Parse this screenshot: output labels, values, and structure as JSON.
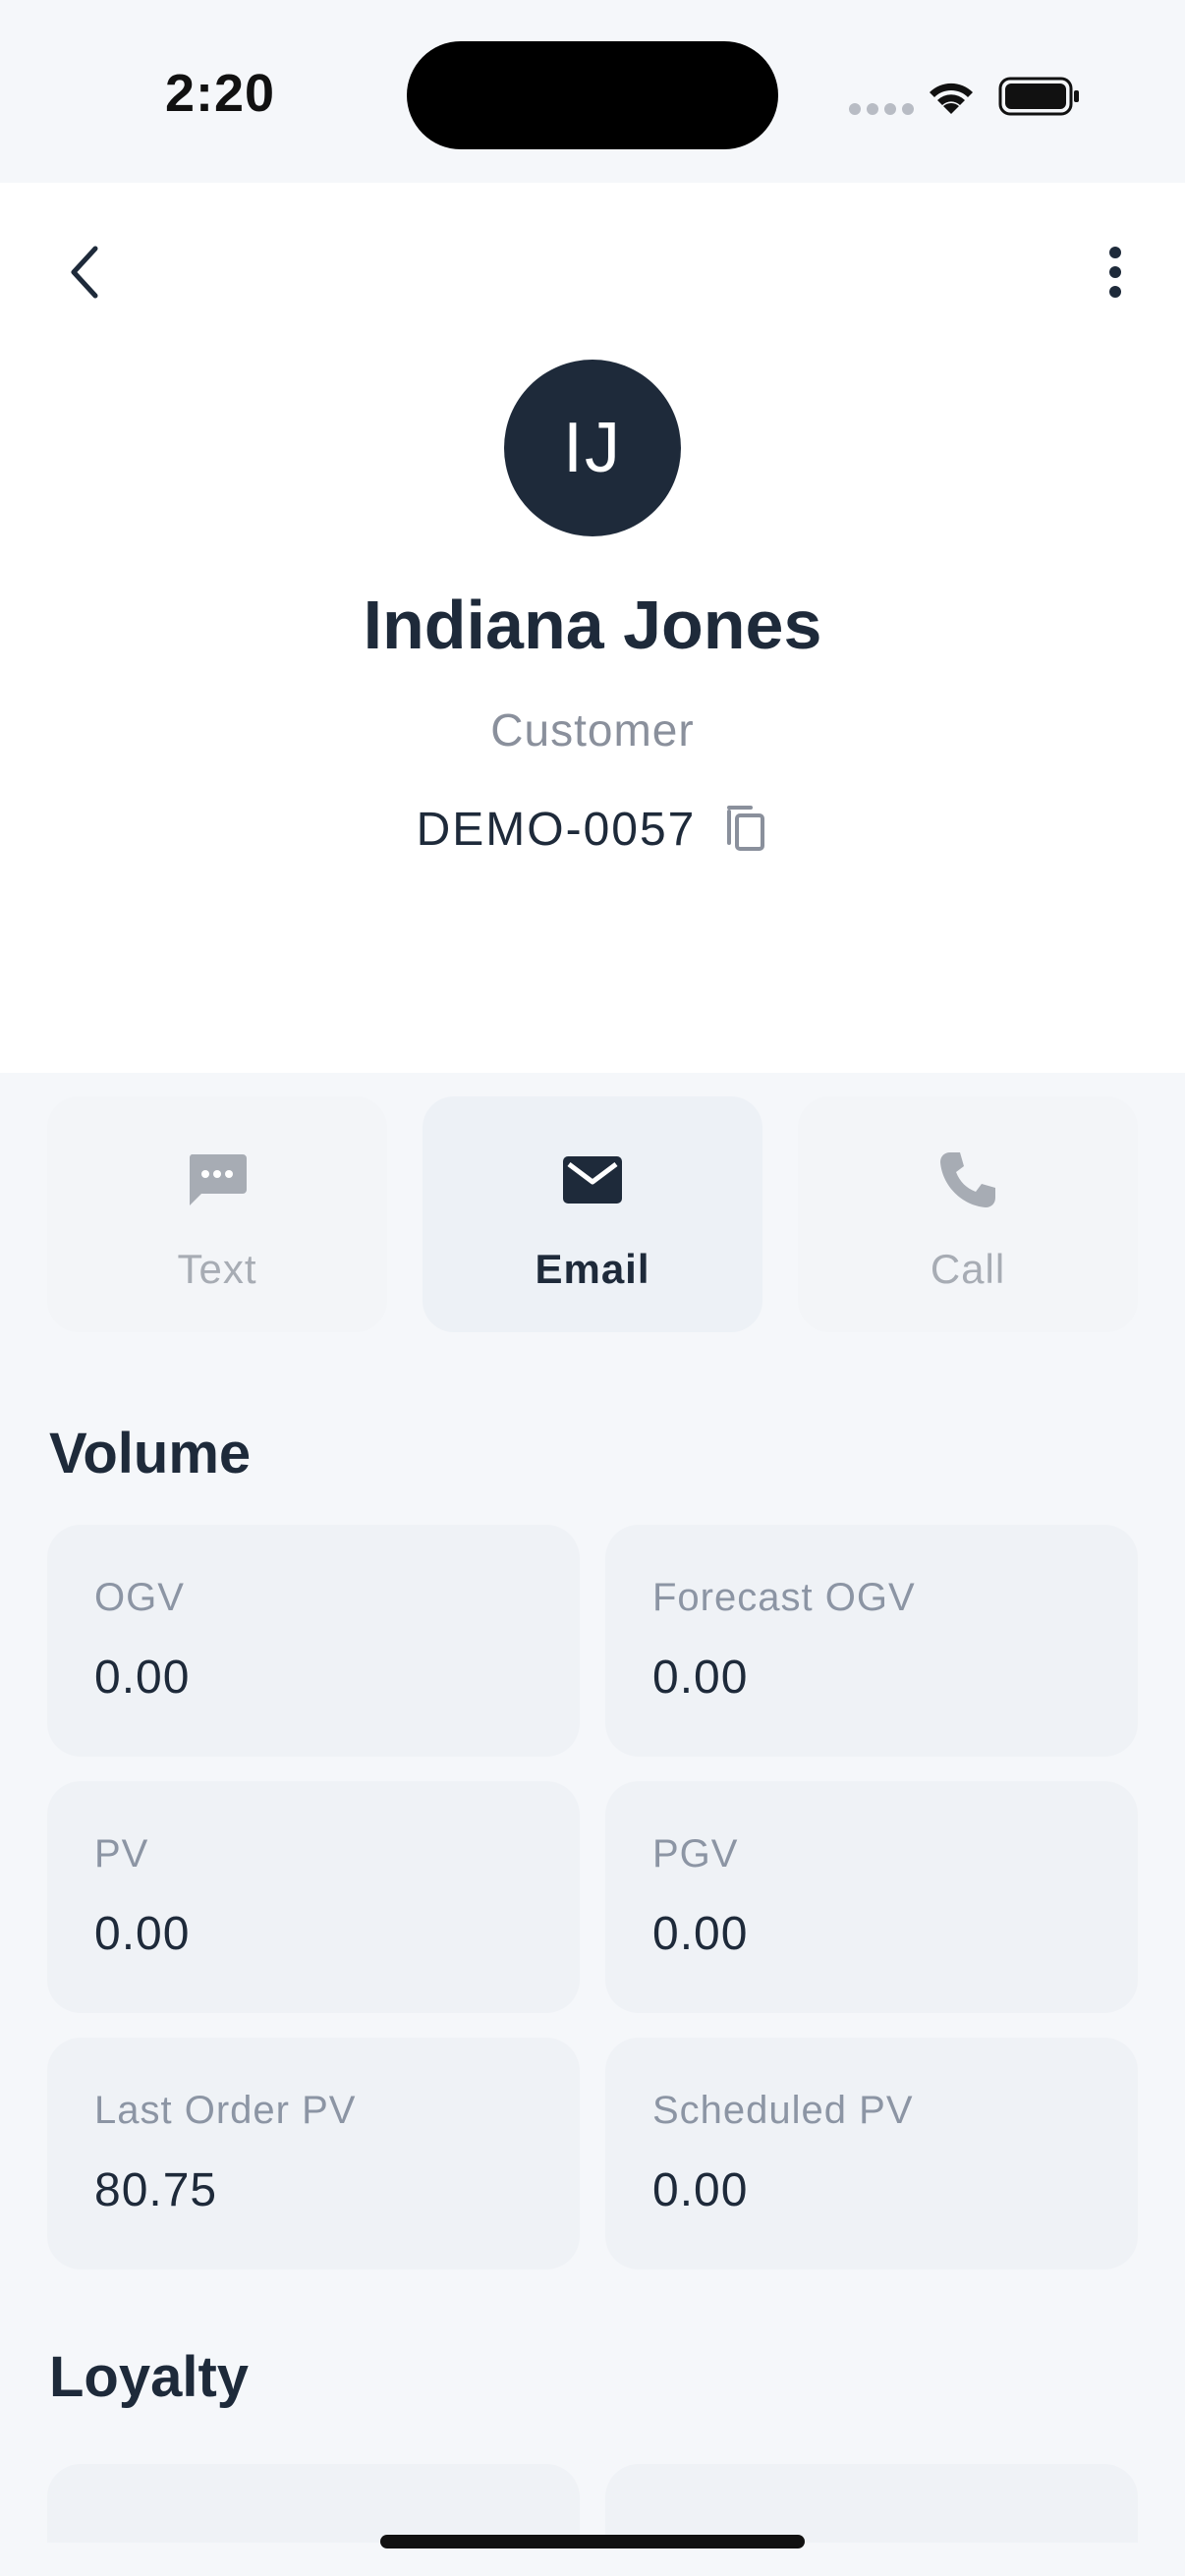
{
  "status_bar": {
    "time": "2:20"
  },
  "profile": {
    "initials": "IJ",
    "name": "Indiana Jones",
    "role": "Customer",
    "id": "DEMO-0057"
  },
  "actions": [
    {
      "label": "Text",
      "icon": "message-icon",
      "state": "disabled"
    },
    {
      "label": "Email",
      "icon": "mail-icon",
      "state": "active"
    },
    {
      "label": "Call",
      "icon": "phone-icon",
      "state": "disabled"
    }
  ],
  "volume": {
    "title": "Volume",
    "stats": [
      {
        "label": "OGV",
        "value": "0.00"
      },
      {
        "label": "Forecast OGV",
        "value": "0.00"
      },
      {
        "label": "PV",
        "value": "0.00"
      },
      {
        "label": "PGV",
        "value": "0.00"
      },
      {
        "label": "Last Order PV",
        "value": "80.75"
      },
      {
        "label": "Scheduled PV",
        "value": "0.00"
      }
    ]
  },
  "loyalty": {
    "title": "Loyalty"
  },
  "colors": {
    "primary": "#1e2a3a",
    "muted": "#8a909c",
    "card_bg": "#eff2f6",
    "page_bg": "#f5f7fa"
  }
}
